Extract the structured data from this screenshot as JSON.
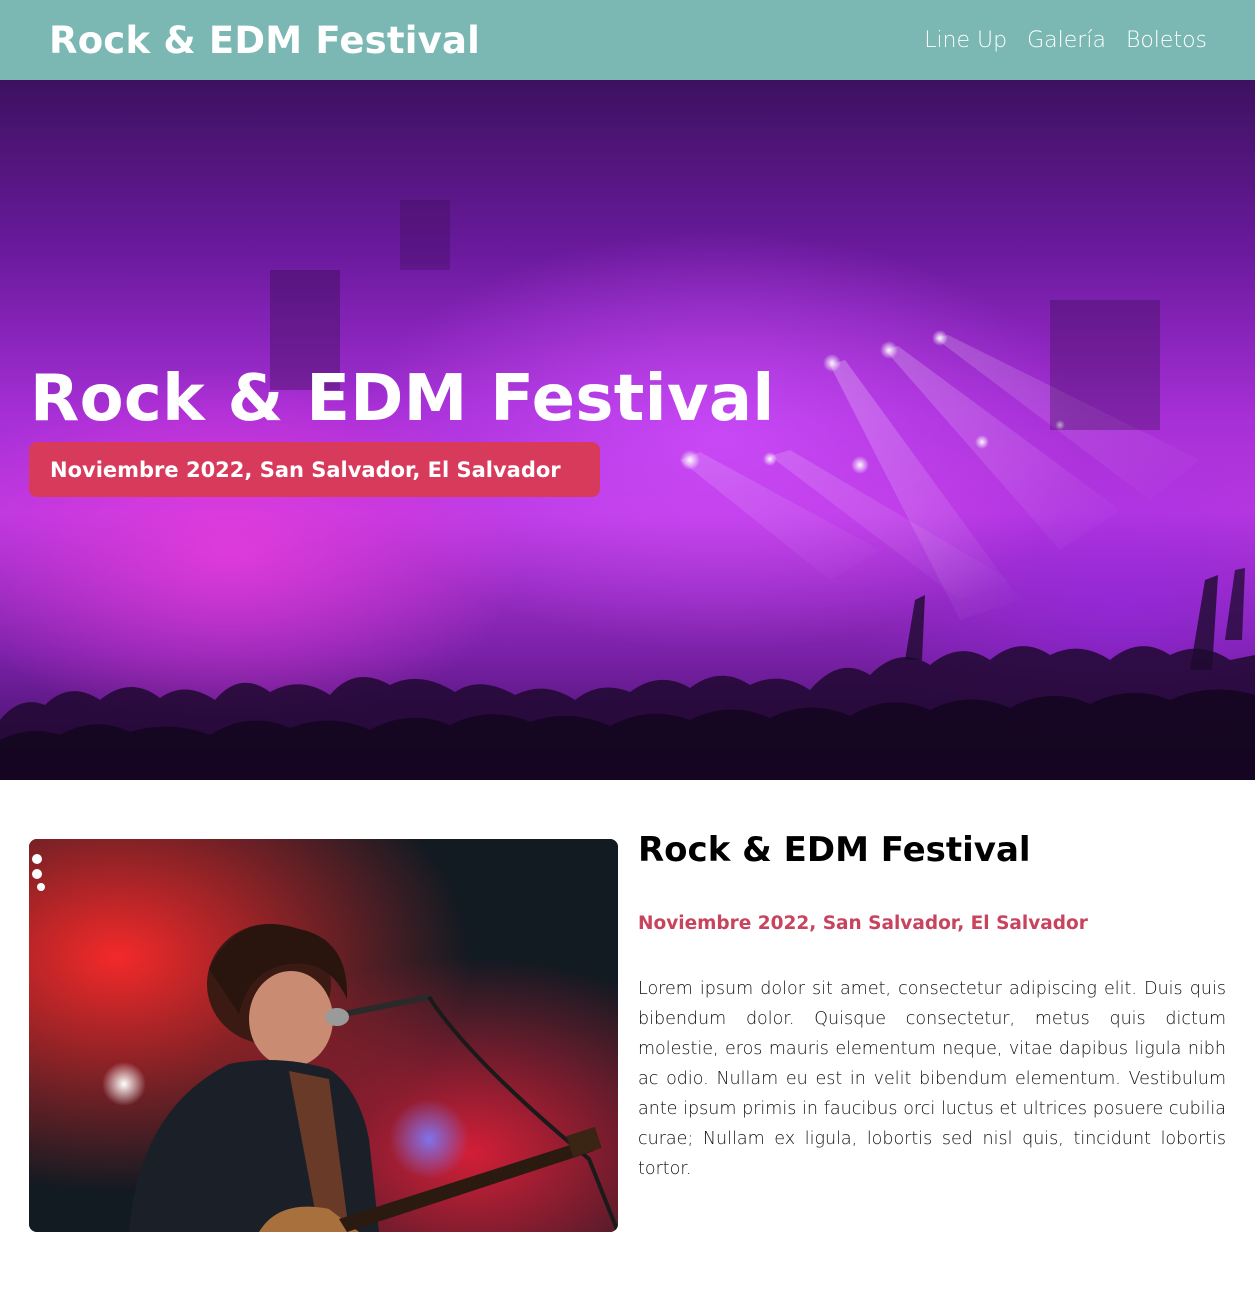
{
  "header": {
    "logo": "Rock & EDM Festival",
    "nav": [
      {
        "label": "Line Up"
      },
      {
        "label": "Galería"
      },
      {
        "label": "Boletos"
      }
    ]
  },
  "hero": {
    "title": "Rock & EDM Festival",
    "badge": "Noviembre 2022, San Salvador, El Salvador"
  },
  "about": {
    "title": "Rock & EDM Festival",
    "date": "Noviembre 2022, San Salvador, El Salvador",
    "text": "Lorem ipsum dolor sit amet, consectetur adipiscing elit. Duis quis bibendum dolor. Quisque consectetur, metus quis dictum molestie, eros mauris elementum neque, vitae dapibus ligula nibh ac odio. Nullam eu est in velit bibendum elementum. Vestibulum ante ipsum primis in faucibus orci luctus et ultrices posuere cubilia curae; Nullam ex ligula, lobortis sed nisl quis, tincidunt lobortis tortor."
  },
  "colors": {
    "header_bg": "#7bb8b3",
    "badge_bg": "#d83a5c",
    "date_text": "#c8435e"
  }
}
